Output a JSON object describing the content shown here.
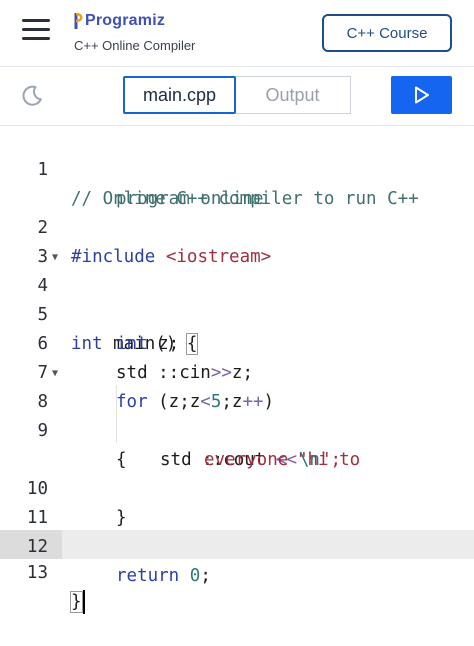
{
  "header": {
    "logo_text": "Programiz",
    "subtitle": "C++ Online Compiler",
    "course_button_label": "C++ Course"
  },
  "toolbar": {
    "tabs": [
      {
        "label": "main.cpp",
        "active": true
      },
      {
        "label": "Output",
        "active": false
      }
    ],
    "theme_icon": "moon-icon",
    "run_icon": "play-icon"
  },
  "colors": {
    "accent": "#1565f0",
    "brand": "#3f51b5",
    "course_border": "#1d4e8a"
  },
  "editor": {
    "active_line": 13,
    "lines": [
      {
        "num": "1",
        "parts": [
          "// Online C++ compiler to run C++"
        ]
      },
      {
        "num": "",
        "parts": [
          "program online"
        ]
      },
      {
        "num": "2",
        "parts": [
          "#include",
          " ",
          "<iostream>"
        ]
      },
      {
        "num": "3",
        "parts": [
          ""
        ]
      },
      {
        "num": "4",
        "parts": [
          "int",
          " main() ",
          "{"
        ]
      },
      {
        "num": "5",
        "parts": [
          "int",
          " z;"
        ]
      },
      {
        "num": "6",
        "parts": [
          "std ::cin",
          ">>",
          "z;"
        ]
      },
      {
        "num": "7",
        "parts": [
          "for",
          " (z;z",
          "<",
          "5",
          ";z",
          "++",
          ")"
        ]
      },
      {
        "num": "8",
        "parts": [
          "{"
        ]
      },
      {
        "num": "9",
        "parts": [
          "std ::cout ",
          "<<",
          "\"hi to"
        ]
      },
      {
        "num": "",
        "parts": [
          "everyone ",
          "\\n",
          "\";"
        ]
      },
      {
        "num": "10",
        "parts": [
          "}"
        ]
      },
      {
        "num": "11",
        "parts": [
          ""
        ]
      },
      {
        "num": "12",
        "parts": [
          "return",
          " ",
          "0",
          ";"
        ]
      },
      {
        "num": "13",
        "parts": [
          "}"
        ]
      }
    ]
  }
}
